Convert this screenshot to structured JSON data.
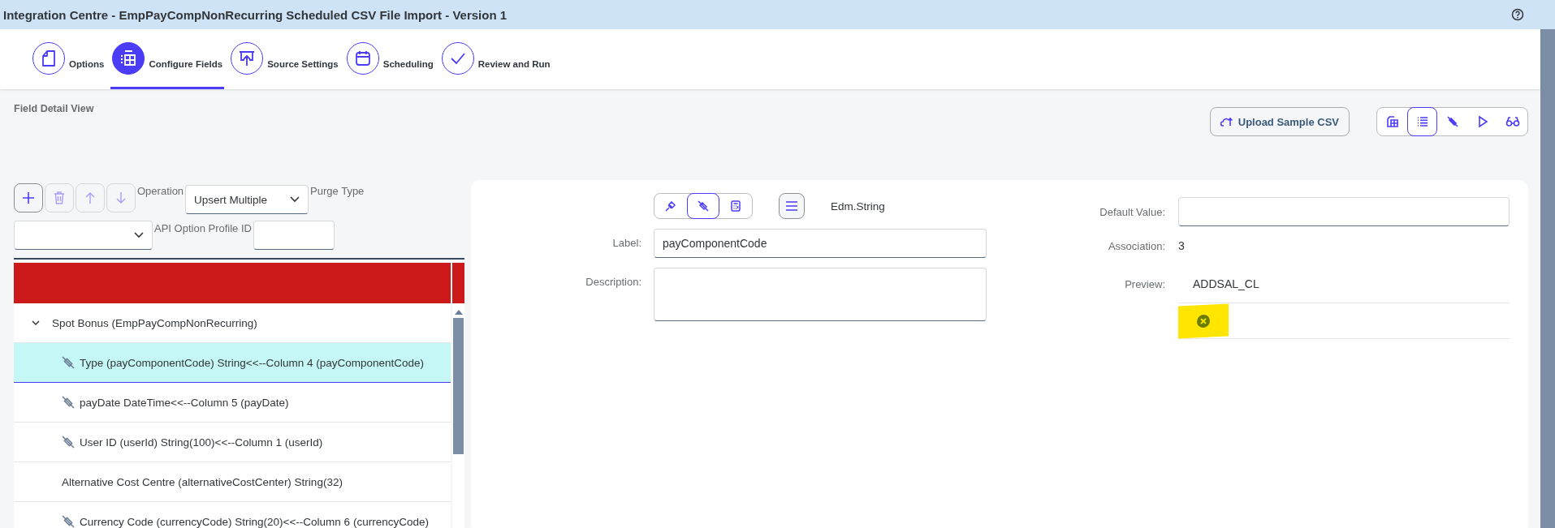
{
  "window": {
    "title": "Integration Centre - EmpPayCompNonRecurring Scheduled CSV File Import - Version 1"
  },
  "steps": [
    {
      "label": "Options",
      "selected": false
    },
    {
      "label": "Configure Fields",
      "selected": true
    },
    {
      "label": "Source Settings",
      "selected": false
    },
    {
      "label": "Scheduling",
      "selected": false
    },
    {
      "label": "Review and Run",
      "selected": false
    }
  ],
  "section_title": "Field Detail View",
  "upload_button": "Upload Sample CSV",
  "view_toolbar": [
    {
      "selected": false
    },
    {
      "selected": true
    },
    {
      "selected": false
    },
    {
      "selected": false
    },
    {
      "selected": false
    }
  ],
  "tree_toolbar": [
    {
      "disabled": false
    },
    {
      "disabled": true
    },
    {
      "disabled": true
    },
    {
      "disabled": true
    }
  ],
  "operation": {
    "label": "Operation",
    "value": "Upsert Multiple"
  },
  "purge_type": {
    "label": "Purge Type"
  },
  "api_option_profile": {
    "label": "API Option Profile ID"
  },
  "tree": [
    {
      "label": "Spot Bonus (EmpPayCompNonRecurring)",
      "expanded": true,
      "selected": false,
      "children": [
        {
          "label": "Type (payComponentCode) String<<--Column 4 (payComponentCode)",
          "mapped": true,
          "selected": true
        },
        {
          "label": "payDate DateTime<<--Column 5 (payDate)",
          "mapped": true,
          "selected": false
        },
        {
          "label": "User ID (userId) String(100)<<--Column 1 (userId)",
          "mapped": true,
          "selected": false
        },
        {
          "label": "Alternative Cost Centre (alternativeCostCenter) String(32)",
          "mapped": false,
          "selected": false
        },
        {
          "label": "Currency Code (currencyCode) String(20)<<--Column 6 (currencyCode)",
          "mapped": true,
          "selected": false
        }
      ]
    }
  ],
  "detail": {
    "mode_buttons": [
      {
        "selected": false
      },
      {
        "selected": true
      },
      {
        "selected": false
      }
    ],
    "type": "Edm.String",
    "label_field": {
      "label": "Label:",
      "value": "payComponentCode"
    },
    "description_field": {
      "label": "Description:"
    },
    "default_value": {
      "label": "Default Value:"
    },
    "association": {
      "label": "Association:",
      "value": "3"
    },
    "preview": {
      "label": "Preview:",
      "value": "ADDSAL_CL"
    },
    "highlight": true
  }
}
